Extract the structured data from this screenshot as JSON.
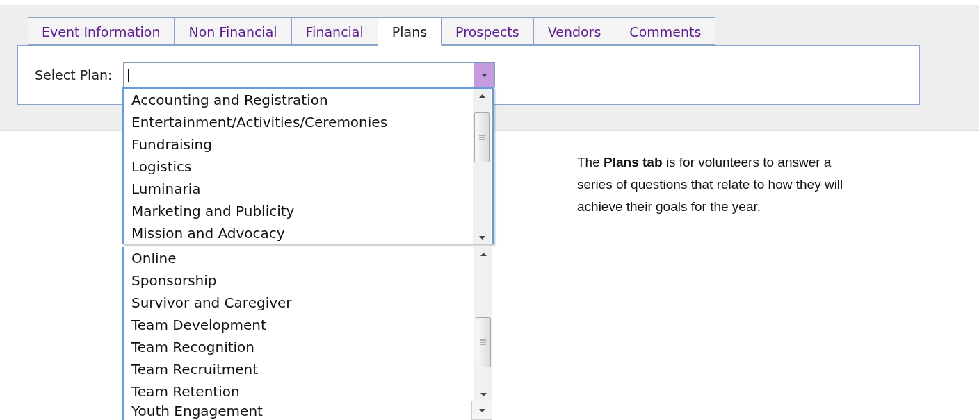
{
  "tabs": [
    {
      "label": "Event Information",
      "selected": false
    },
    {
      "label": "Non Financial",
      "selected": false
    },
    {
      "label": "Financial",
      "selected": false
    },
    {
      "label": "Plans",
      "selected": true
    },
    {
      "label": "Prospects",
      "selected": false
    },
    {
      "label": "Vendors",
      "selected": false
    },
    {
      "label": "Comments",
      "selected": false
    }
  ],
  "select_plan": {
    "label": "Select Plan:",
    "focused": true
  },
  "dropdown_lists": [
    {
      "items": [
        "Accounting and Registration",
        "Entertainment/Activities/Ceremonies",
        "Fundraising",
        "Logistics",
        "Luminaria",
        "Marketing and Publicity",
        "Mission and Advocacy"
      ]
    },
    {
      "items": [
        "Online",
        "Sponsorship",
        "Survivor and Caregiver",
        "Team Development",
        "Team Recognition",
        "Team Recruitment",
        "Team Retention"
      ]
    }
  ],
  "last_option": {
    "text": "Youth Engagement"
  },
  "note": "The **Plans tab** is for volunteers to answer a series of questions that relate to how they will achieve their goals for the year."
}
